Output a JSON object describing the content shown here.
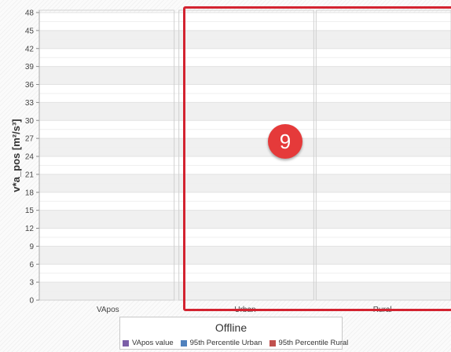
{
  "chart_data": {
    "type": "bar",
    "categories": [
      "VApos",
      "Urban",
      "Rural"
    ],
    "series": [
      {
        "name": "VApos value",
        "values": [
          0,
          0,
          0
        ]
      },
      {
        "name": "95th Percentile Urban",
        "values": [
          0,
          0,
          0
        ]
      },
      {
        "name": "95th Percentile Rural",
        "values": [
          0,
          0,
          0
        ]
      }
    ],
    "ylabel": "v*a_pos [m²/s³]",
    "ylim": [
      0,
      48
    ],
    "yticks": [
      0,
      3,
      6,
      9,
      12,
      15,
      18,
      21,
      24,
      27,
      30,
      33,
      36,
      39,
      42,
      45,
      48
    ],
    "grid": true,
    "legend_title": "Offline",
    "legend_position": "bottom-center",
    "colors": {
      "VApos value": "#7b5ea7",
      "95th Percentile Urban": "#4f81bd",
      "95th Percentile Rural": "#c0504d",
      "highlight": "#d32330",
      "badge": "#e53a3a"
    }
  },
  "annotation": {
    "badge_number": "9"
  }
}
